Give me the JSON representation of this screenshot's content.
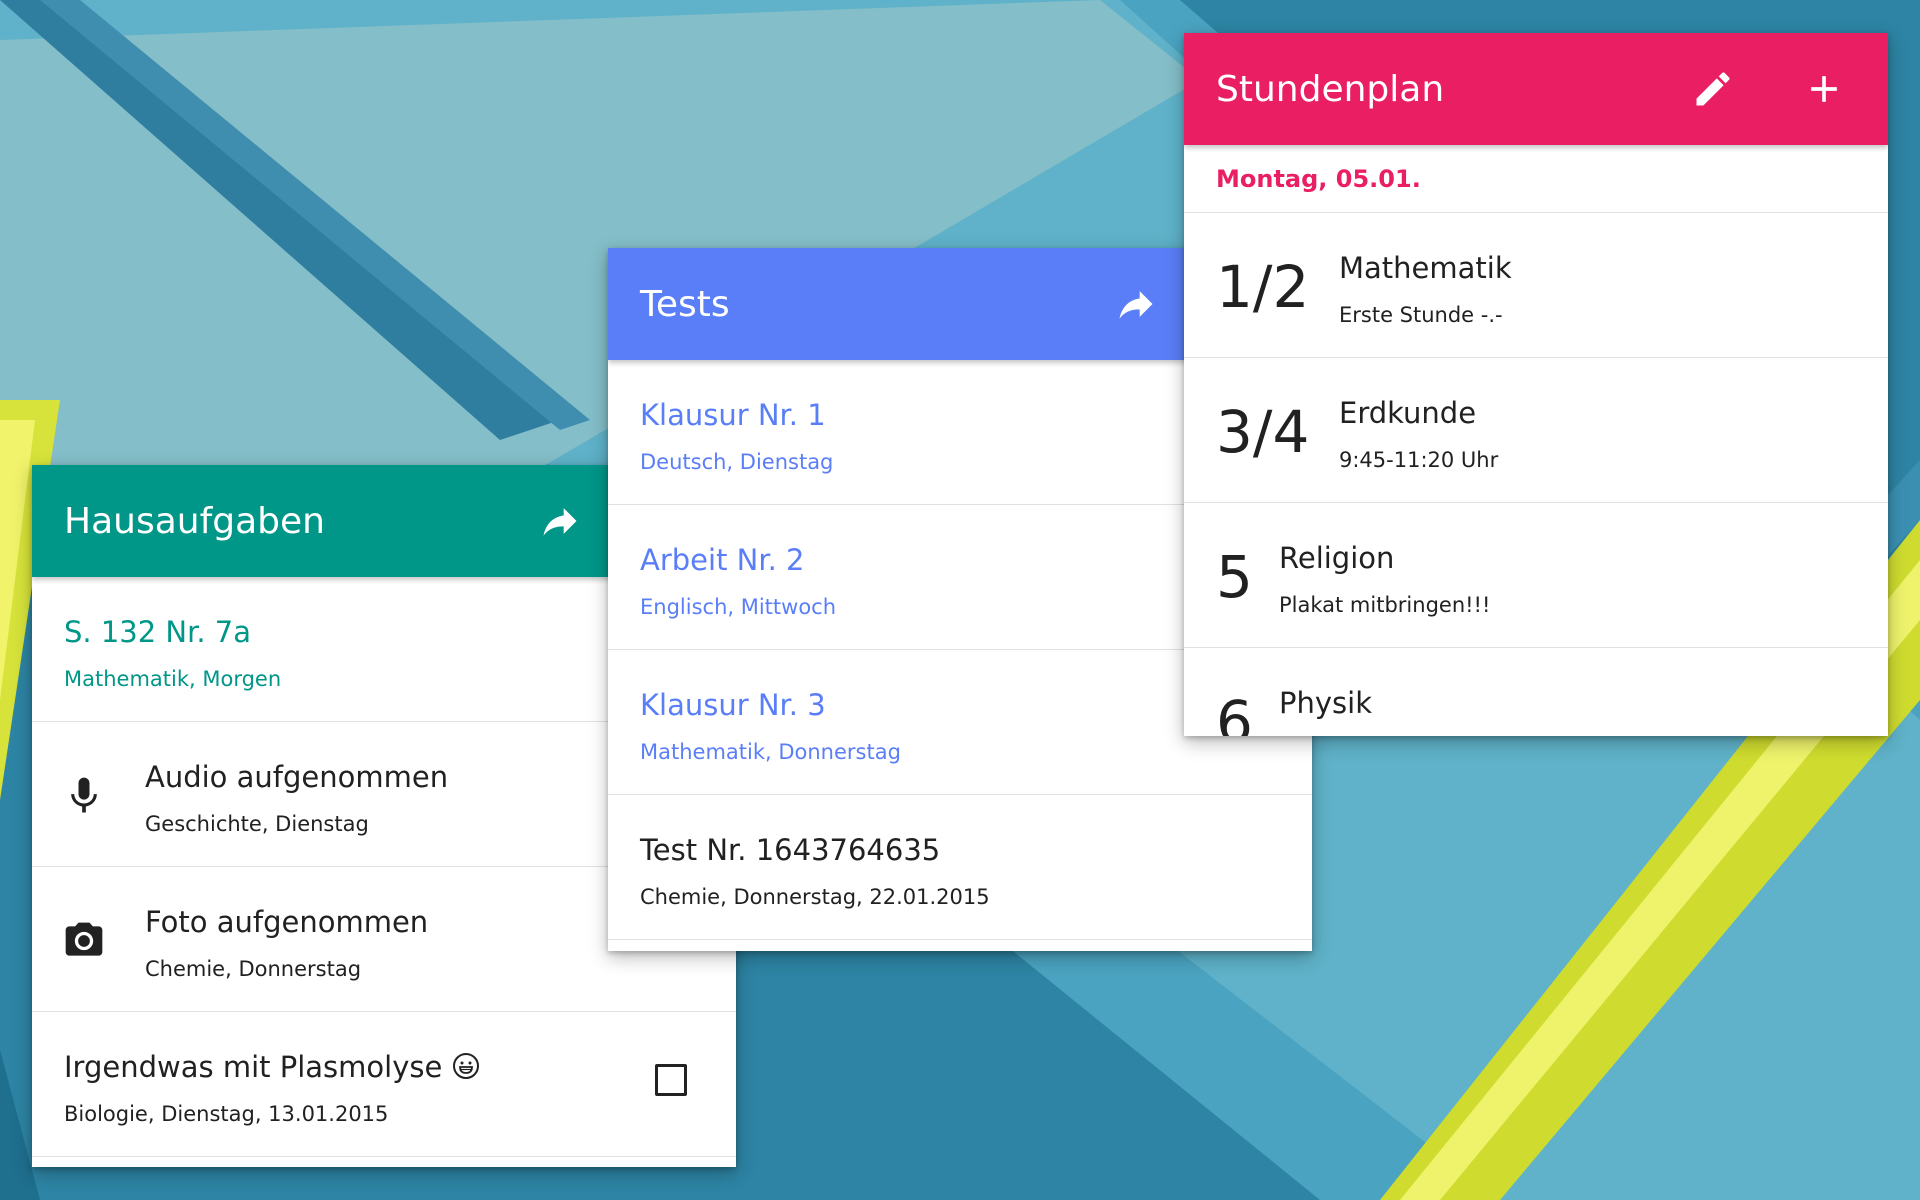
{
  "colors": {
    "homework_accent": "#009688",
    "tests_accent": "#5a7ef7",
    "schedule_accent": "#e91e63"
  },
  "homework": {
    "title": "Hausaufgaben",
    "header_icon": "share-icon",
    "items": [
      {
        "title": "S. 132 Nr. 7a",
        "subtitle": "Mathematik, Morgen"
      },
      {
        "icon": "microphone-icon",
        "title": "Audio aufgenommen",
        "subtitle": "Geschichte, Dienstag"
      },
      {
        "icon": "camera-icon",
        "title": "Foto aufgenommen",
        "subtitle": "Chemie, Donnerstag"
      },
      {
        "title": "Irgendwas mit Plasmolyse",
        "emoji": "grinning-face-icon",
        "subtitle": "Biologie, Dienstag, 13.01.2015",
        "checked": false
      }
    ]
  },
  "tests": {
    "title": "Tests",
    "header_icon": "share-icon",
    "items": [
      {
        "title": "Klausur Nr. 1",
        "subtitle": "Deutsch, Dienstag"
      },
      {
        "title": "Arbeit Nr. 2",
        "subtitle": "Englisch, Mittwoch"
      },
      {
        "title": "Klausur Nr. 3",
        "subtitle": "Mathematik, Donnerstag"
      },
      {
        "title": "Test Nr. 1643764635",
        "subtitle": "Chemie, Donnerstag, 22.01.2015"
      }
    ]
  },
  "schedule": {
    "title": "Stundenplan",
    "edit_icon": "pencil-icon",
    "add_icon": "plus-icon",
    "date": "Montag, 05.01.",
    "lessons": [
      {
        "period": "1/2",
        "subject": "Mathematik",
        "note": "Erste Stunde -.-"
      },
      {
        "period": "3/4",
        "subject": "Erdkunde",
        "note": "9:45-11:20 Uhr"
      },
      {
        "period": "5",
        "subject": "Religion",
        "note": "Plakat mitbringen!!!"
      },
      {
        "period": "6",
        "subject": "Physik",
        "note": ""
      }
    ]
  }
}
